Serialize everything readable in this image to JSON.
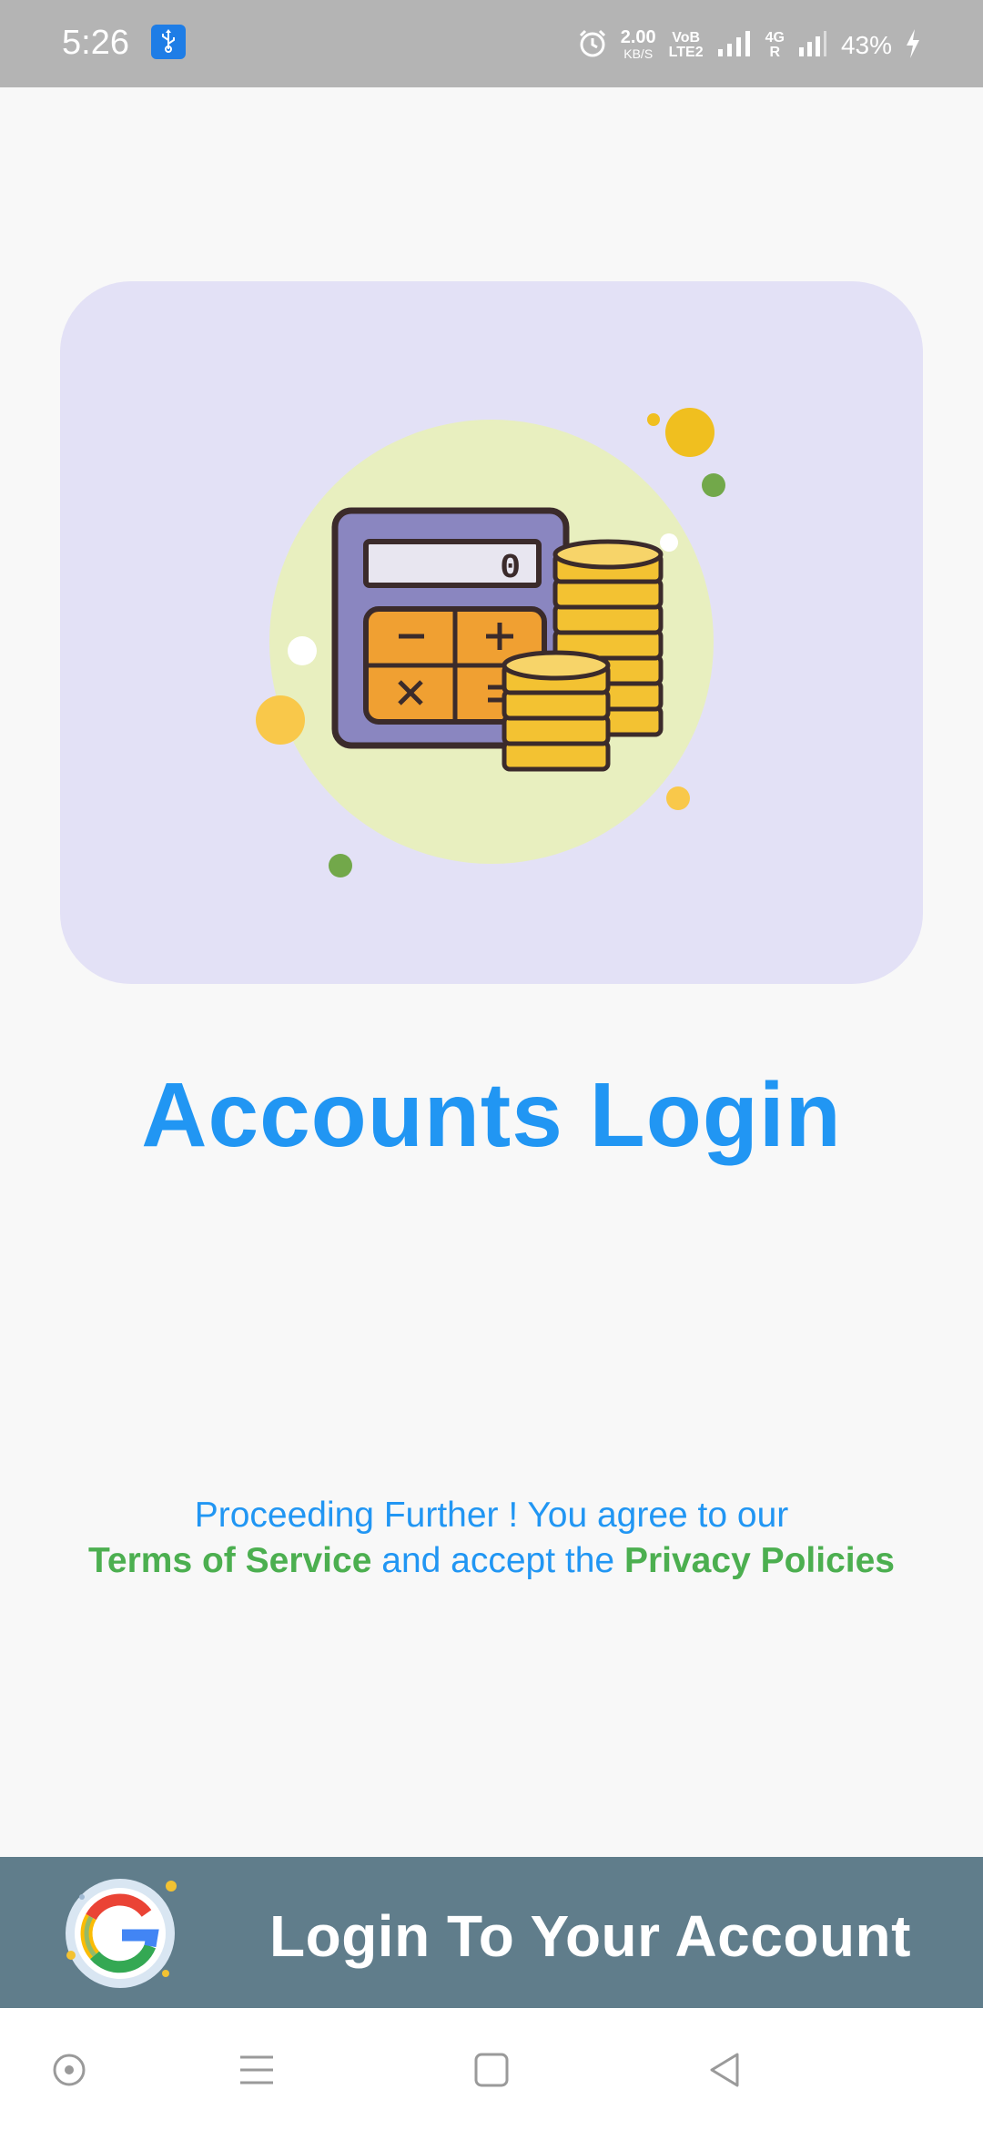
{
  "status_bar": {
    "time": "5:26",
    "net_speed_value": "2.00",
    "net_speed_unit": "KB/S",
    "volte_label_top": "VoB",
    "volte_label_bottom": "LTE2",
    "network_label_top": "4G",
    "network_label_bottom": "R",
    "battery_percent": "43%",
    "icons": [
      "usb-icon",
      "alarm-icon",
      "signal-icon",
      "charging-icon"
    ]
  },
  "hero": {
    "illustration": "calculator-with-coins",
    "calculator_display": "0",
    "colors": {
      "card_bg": "#e3e1f6",
      "circle_bg": "#e8efbf"
    }
  },
  "title": "Accounts Login",
  "legal": {
    "line1": "Proceeding Further ! You agree to our",
    "terms_link": "Terms of Service",
    "middle": "and accept the",
    "privacy_link": "Privacy Policies"
  },
  "login": {
    "label": "Login To Your Account",
    "icon": "google-icon"
  },
  "nav": {
    "icons": [
      "assistant-icon",
      "menu-icon",
      "home-icon",
      "back-icon"
    ]
  },
  "colors": {
    "accent": "#2196f3",
    "link": "#4caf50",
    "login_bar": "#607d8b",
    "status_bar": "#b4b4b4"
  }
}
